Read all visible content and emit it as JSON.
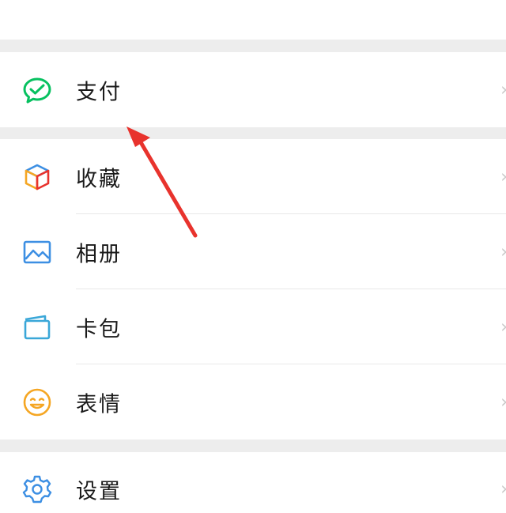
{
  "menu": {
    "pay": {
      "label": "支付",
      "icon": "wechat-pay-icon"
    },
    "favorites": {
      "label": "收藏",
      "icon": "cube-icon"
    },
    "album": {
      "label": "相册",
      "icon": "image-icon"
    },
    "cards": {
      "label": "卡包",
      "icon": "card-wallet-icon"
    },
    "stickers": {
      "label": "表情",
      "icon": "smiley-icon"
    },
    "settings": {
      "label": "设置",
      "icon": "gear-icon"
    }
  },
  "colors": {
    "page_bg": "#ededed",
    "row_bg": "#ffffff",
    "pay_green": "#07c160",
    "blue": "#3d8fe3",
    "smiley_orange": "#f5a623",
    "annotation_red": "#e8332d"
  }
}
